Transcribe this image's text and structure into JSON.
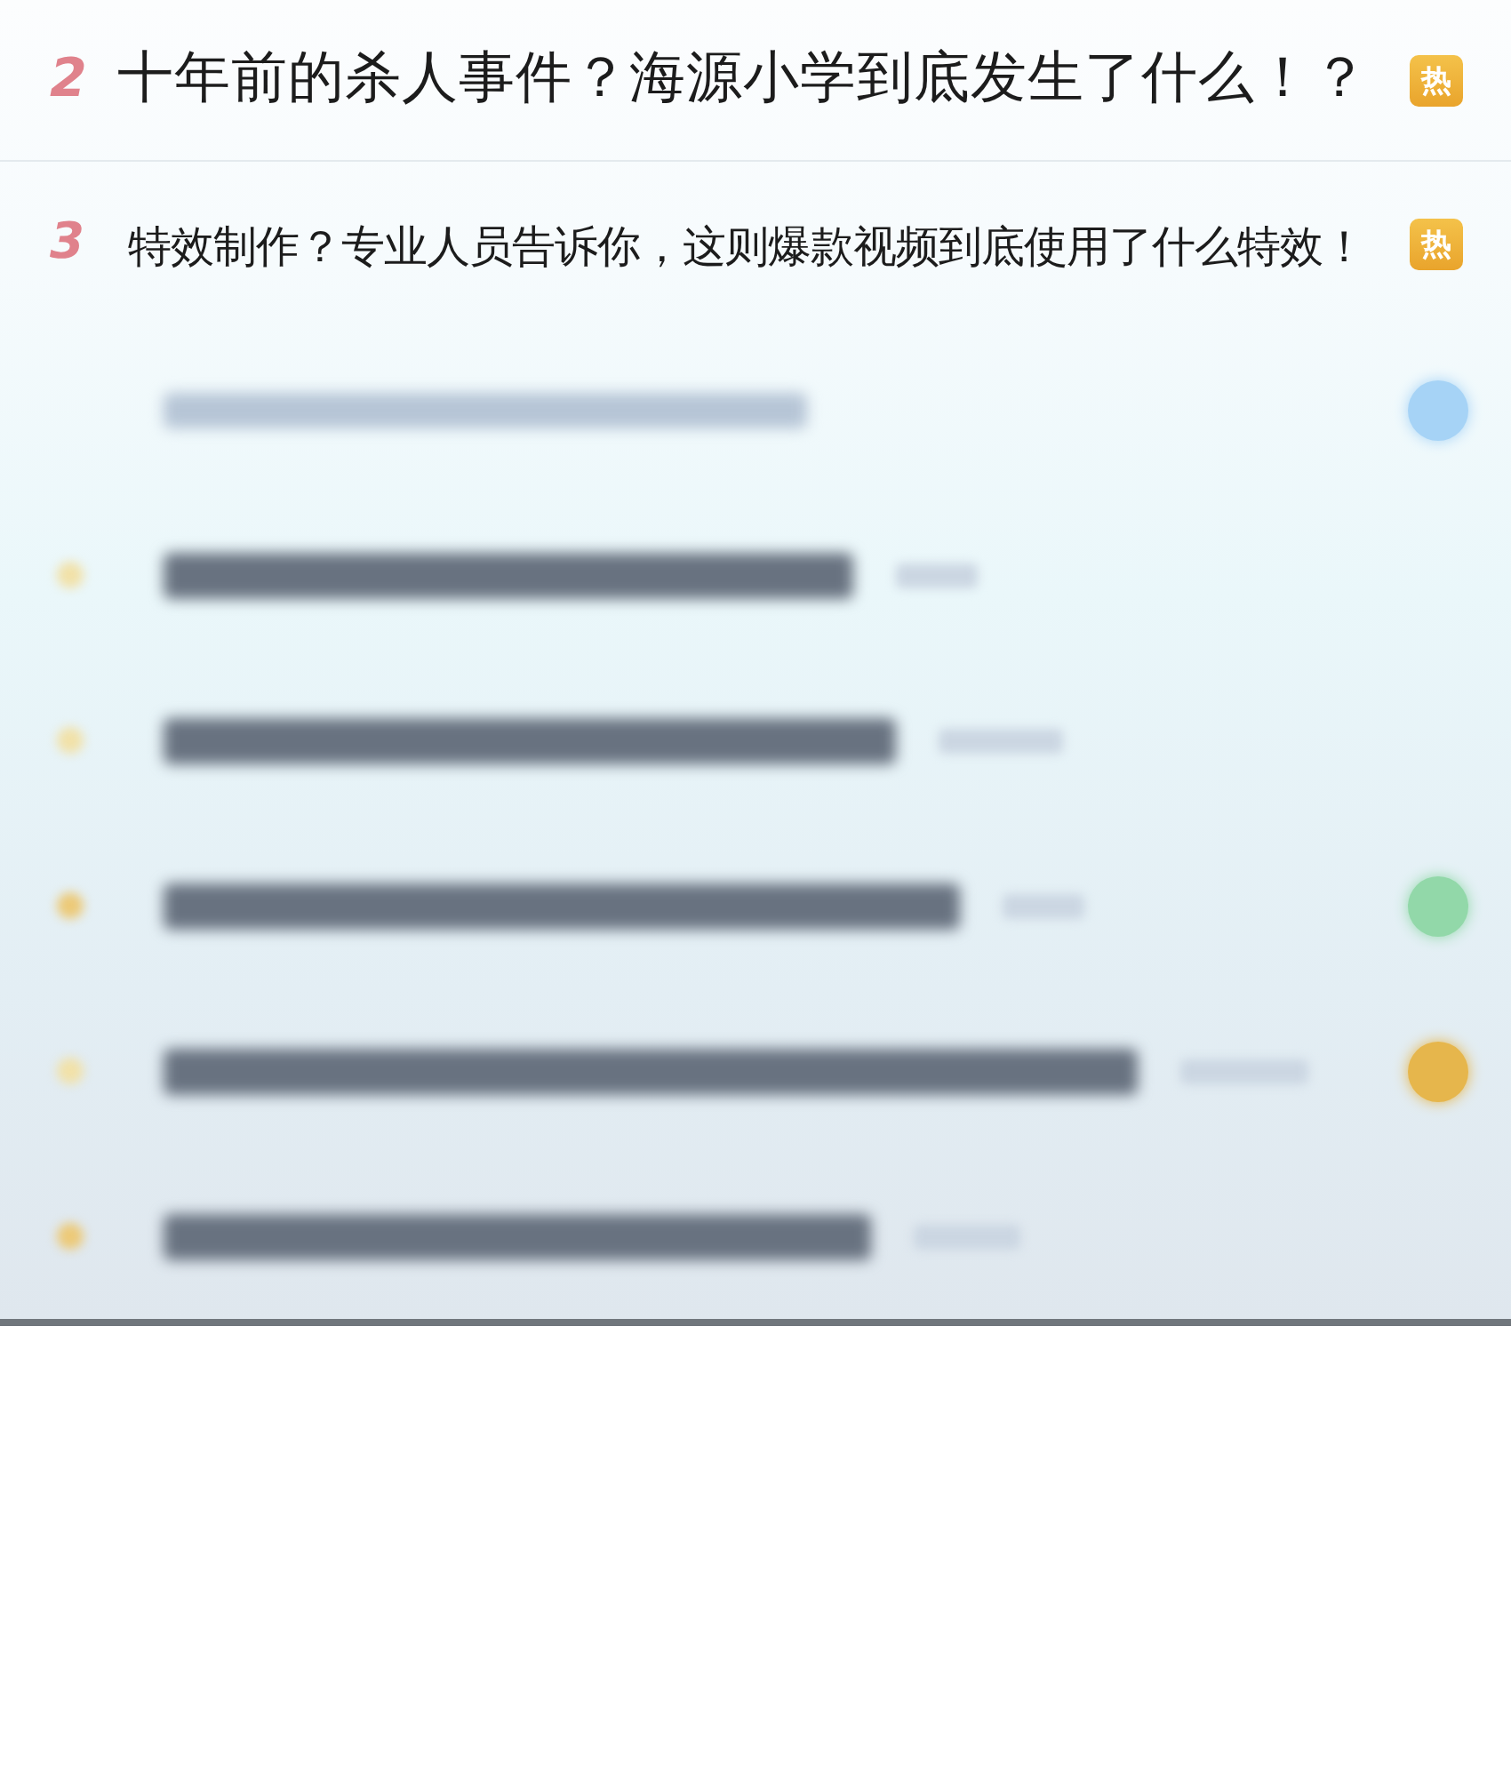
{
  "trending": [
    {
      "kind": "headline",
      "rank": "2",
      "title": "十年前的杀人事件？海源小学到底发生了什么！？",
      "badge": "热"
    },
    {
      "kind": "item",
      "rank": "3",
      "title": "特效制作？专业人员告诉你，这则爆款视频到底使用了什么特效！",
      "badge": "热"
    }
  ],
  "blurred_rows": [
    {
      "badge": true,
      "color": "#a6d3f6"
    },
    {
      "badge": false
    },
    {
      "badge": false
    },
    {
      "badge": true,
      "color": "#92d8a9"
    },
    {
      "badge": true,
      "color": "#e6b64c"
    },
    {
      "badge": false
    }
  ]
}
